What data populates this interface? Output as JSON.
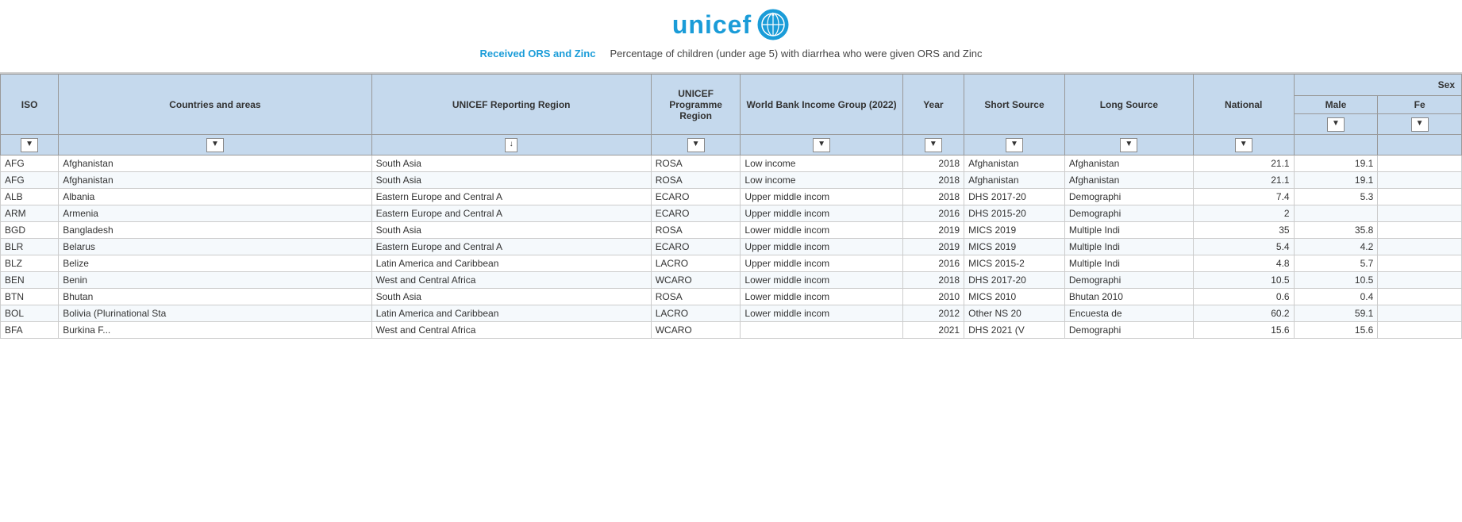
{
  "logo": {
    "text": "unicef",
    "emblem": "🌐"
  },
  "report": {
    "title": "Received ORS and Zinc",
    "description": "Percentage of children (under age 5) with diarrhea who were given ORS and Zinc"
  },
  "table": {
    "columns": {
      "iso": "ISO",
      "countries": "Countries and areas",
      "empty": "",
      "region": "UNICEF Reporting Region",
      "programme": "UNICEF Programme Region",
      "wb": "World Bank Income Group (2022)",
      "year": "Year",
      "short_source": "Short Source",
      "long_source": "Long Source",
      "national": "National",
      "sex": "Sex",
      "male": "Male",
      "female": "Fe"
    },
    "rows": [
      {
        "iso": "AFG",
        "country": "Afghanistan",
        "empty": "",
        "region": "South Asia",
        "programme": "ROSA",
        "wb": "Low income",
        "year": "2018",
        "short": "Afghanistan",
        "long": "Afghanistan",
        "national": "21.1",
        "male": "19.1",
        "female": ""
      },
      {
        "iso": "AFG",
        "country": "Afghanistan",
        "empty": "",
        "region": "South Asia",
        "programme": "ROSA",
        "wb": "Low income",
        "year": "2018",
        "short": "Afghanistan",
        "long": "Afghanistan",
        "national": "21.1",
        "male": "19.1",
        "female": ""
      },
      {
        "iso": "ALB",
        "country": "Albania",
        "empty": "",
        "region": "Eastern Europe and Central A",
        "programme": "ECARO",
        "wb": "Upper middle incom",
        "year": "2018",
        "short": "DHS 2017-20",
        "long": "Demographi",
        "national": "7.4",
        "male": "5.3",
        "female": ""
      },
      {
        "iso": "ARM",
        "country": "Armenia",
        "empty": "",
        "region": "Eastern Europe and Central A",
        "programme": "ECARO",
        "wb": "Upper middle incom",
        "year": "2016",
        "short": "DHS 2015-20",
        "long": "Demographi",
        "national": "2",
        "male": "",
        "female": ""
      },
      {
        "iso": "BGD",
        "country": "Bangladesh",
        "empty": "",
        "region": "South Asia",
        "programme": "ROSA",
        "wb": "Lower middle incom",
        "year": "2019",
        "short": "MICS 2019",
        "long": "Multiple Indi",
        "national": "35",
        "male": "35.8",
        "female": ""
      },
      {
        "iso": "BLR",
        "country": "Belarus",
        "empty": "",
        "region": "Eastern Europe and Central A",
        "programme": "ECARO",
        "wb": "Upper middle incom",
        "year": "2019",
        "short": "MICS 2019",
        "long": "Multiple Indi",
        "national": "5.4",
        "male": "4.2",
        "female": ""
      },
      {
        "iso": "BLZ",
        "country": "Belize",
        "empty": "",
        "region": "Latin America and Caribbean",
        "programme": "LACRO",
        "wb": "Upper middle incom",
        "year": "2016",
        "short": "MICS 2015-2",
        "long": "Multiple Indi",
        "national": "4.8",
        "male": "5.7",
        "female": ""
      },
      {
        "iso": "BEN",
        "country": "Benin",
        "empty": "",
        "region": "West and Central Africa",
        "programme": "WCARO",
        "wb": "Lower middle incom",
        "year": "2018",
        "short": "DHS 2017-20",
        "long": "Demographi",
        "national": "10.5",
        "male": "10.5",
        "female": ""
      },
      {
        "iso": "BTN",
        "country": "Bhutan",
        "empty": "",
        "region": "South Asia",
        "programme": "ROSA",
        "wb": "Lower middle incom",
        "year": "2010",
        "short": "MICS 2010",
        "long": "Bhutan 2010",
        "national": "0.6",
        "male": "0.4",
        "female": ""
      },
      {
        "iso": "BOL",
        "country": "Bolivia (Plurinational Sta",
        "empty": "",
        "region": "Latin America and Caribbean",
        "programme": "LACRO",
        "wb": "Lower middle incom",
        "year": "2012",
        "short": "Other NS 20",
        "long": "Encuesta de",
        "national": "60.2",
        "male": "59.1",
        "female": ""
      },
      {
        "iso": "BFA",
        "country": "Burkina F...",
        "empty": "",
        "region": "West and Central Africa",
        "programme": "WCARO",
        "wb": "",
        "year": "2021",
        "short": "DHS 2021 (V",
        "long": "Demographi",
        "national": "15.6",
        "male": "15.6",
        "female": ""
      }
    ]
  }
}
